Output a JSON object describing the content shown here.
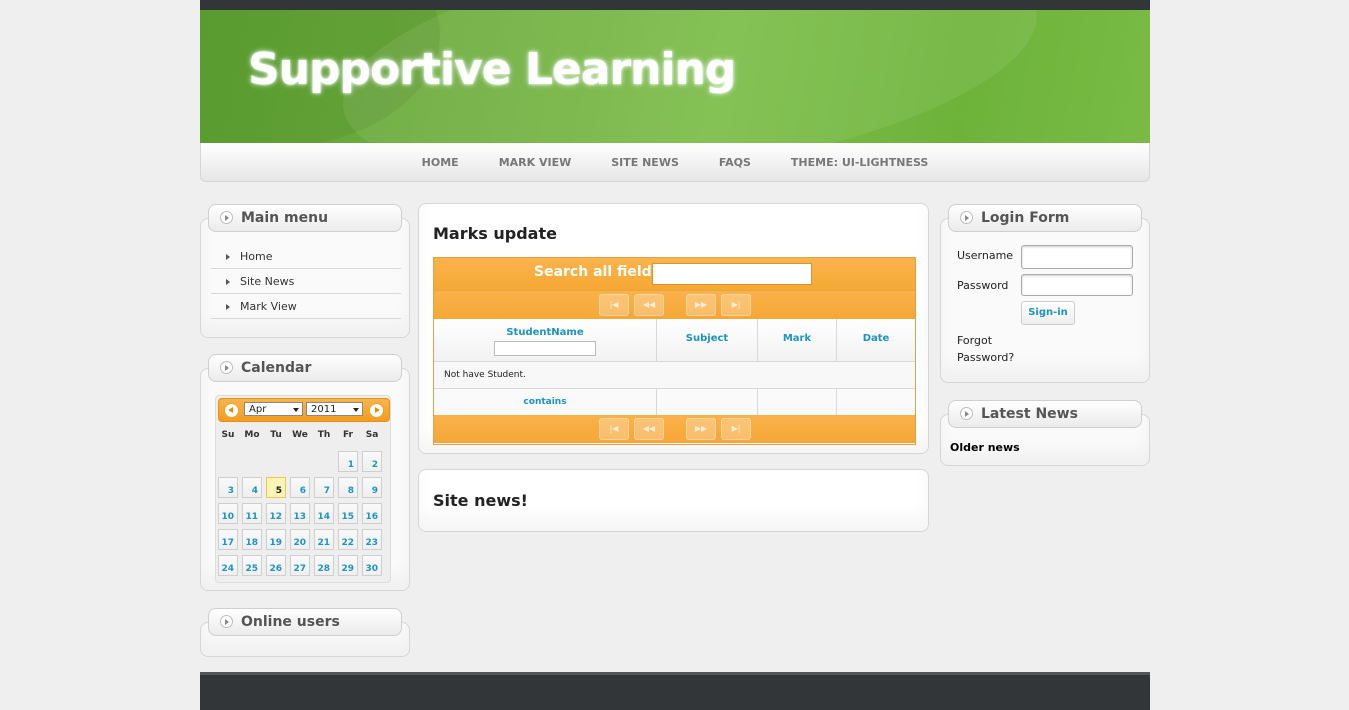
{
  "site": {
    "title": "Supportive Learning"
  },
  "nav": [
    "HOME",
    "MARK VIEW",
    "SITE NEWS",
    "FAQS",
    "THEME: UI-LIGHTNESS"
  ],
  "main_menu": {
    "title": "Main menu",
    "items": [
      "Home",
      "Site News",
      "Mark View"
    ]
  },
  "calendar": {
    "title": "Calendar",
    "month": "Apr",
    "year": "2011",
    "weekdays": [
      "Su",
      "Mo",
      "Tu",
      "We",
      "Th",
      "Fr",
      "Sa"
    ],
    "today": "5",
    "weeks": [
      [
        "",
        "",
        "",
        "",
        "",
        "1",
        "2"
      ],
      [
        "3",
        "4",
        "5",
        "6",
        "7",
        "8",
        "9"
      ],
      [
        "10",
        "11",
        "12",
        "13",
        "14",
        "15",
        "16"
      ],
      [
        "17",
        "18",
        "19",
        "20",
        "21",
        "22",
        "23"
      ],
      [
        "24",
        "25",
        "26",
        "27",
        "28",
        "29",
        "30"
      ]
    ]
  },
  "online_users": {
    "title": "Online users"
  },
  "marks": {
    "title": "Marks update",
    "search_label": "Search all fields:",
    "pager_buttons": [
      "|◀",
      "◀◀",
      "▶▶",
      "▶|"
    ],
    "columns": [
      "StudentName",
      "Subject",
      "Mark",
      "Date"
    ],
    "empty_message": "Not have Student.",
    "filter_op": "contains"
  },
  "site_news": {
    "title": "Site news!"
  },
  "login": {
    "title": "Login Form",
    "username_label": "Username",
    "password_label": "Password",
    "signin_label": "Sign-in",
    "forgot_line1": "Forgot",
    "forgot_line2": "Password?"
  },
  "latest_news": {
    "title": "Latest News",
    "older_link": "Older news"
  },
  "colors": {
    "accent": "#f6a828",
    "banner": "#6db33a",
    "link": "#1c94c4"
  }
}
